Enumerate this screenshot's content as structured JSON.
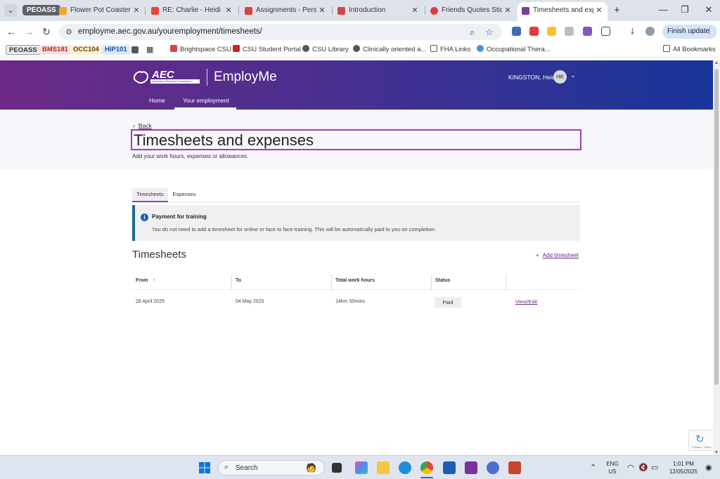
{
  "browser": {
    "tab_group": "PEOASS",
    "tabs": [
      {
        "title": "Flower Pot Coaster Se",
        "favicon_color": "#f4a62a"
      },
      {
        "title": "RE: Charlie - Heidi Kin",
        "favicon_color": "#ea4335"
      },
      {
        "title": "Assignments - Person",
        "favicon_color": "#d64545"
      },
      {
        "title": "Introduction",
        "favicon_color": "#d64545"
      },
      {
        "title": "Friends Quotes Sticke",
        "favicon_color": "#e23b3b"
      },
      {
        "title": "Timesheets and expe",
        "favicon_color": "#7b3fa0"
      }
    ],
    "close_glyph": "✕",
    "new_tab_glyph": "+",
    "window_controls": {
      "minimize": "—",
      "maximize": "❐",
      "close": "✕"
    },
    "url": "employme.aec.gov.au/youremployment/timesheets/",
    "finish_update_label": "Finish update",
    "bookmarks": [
      {
        "label": "PEOASS",
        "bg": "#e8eaed",
        "fg": "#333333"
      },
      {
        "label": "BMS181",
        "bg": "#fde2e1",
        "fg": "#b3261e"
      },
      {
        "label": "OCC104",
        "bg": "#fdf1d5",
        "fg": "#5c4400"
      },
      {
        "label": "HIP101",
        "bg": "#dbe8fb",
        "fg": "#174ea6"
      }
    ],
    "bookmark_links": [
      {
        "label": "Brightspace CSU",
        "favicon_color": "#d64545"
      },
      {
        "label": "CSU Student Portal",
        "favicon_color": "#c62828"
      },
      {
        "label": "CSU Library",
        "favicon_color": "#555555"
      },
      {
        "label": "Clinically oriented a...",
        "favicon_color": "#555555"
      },
      {
        "label": "FHA Links",
        "favicon_color": "#555555"
      },
      {
        "label": "Occupational Thera...",
        "favicon_color": "#4a90e2"
      }
    ],
    "all_bookmarks": "All Bookmarks"
  },
  "header": {
    "logo_text": "AEC",
    "logo_subtext": "Australian Electoral Commission",
    "brand": "EmployMe",
    "user_name": "KINGSTON, Heidi",
    "user_initials": "HK",
    "nav": {
      "home": "Home",
      "employment": "Your employment"
    }
  },
  "page": {
    "back": "Back",
    "title": "Timesheets and expenses",
    "subtitle": "Add your work hours, expenses or allowances.",
    "tabs": [
      {
        "label": "Timesheets"
      },
      {
        "label": "Expenses"
      }
    ],
    "notice": {
      "title": "Payment for training",
      "text": "You do not need to add a timesheet for online or face to face training. This will be automatically paid to you on completion."
    },
    "section_title": "Timesheets",
    "add_timesheet": "Add timesheet",
    "table": {
      "headers": {
        "from": "From",
        "to": "To",
        "hours": "Total work hours",
        "status": "Status"
      },
      "rows": [
        {
          "from": "28 April 2025",
          "to": "04 May 2025",
          "hours": "14hrs 50mins",
          "status": "Paid",
          "action": "View/Edit"
        }
      ]
    },
    "recaptcha_text": "Privacy - Terms"
  },
  "taskbar": {
    "search": "Search",
    "lang_line1": "ENG",
    "lang_line2": "US",
    "time": "1:01 PM",
    "date": "12/05/2025"
  },
  "colors": {
    "accent_purple": "#6a2b8b",
    "highlight_border": "#a636c4",
    "info_blue": "#1565c0"
  }
}
